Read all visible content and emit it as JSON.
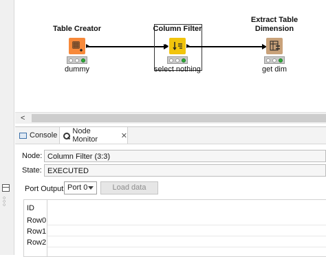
{
  "workflow": {
    "nodes": [
      {
        "title_lines": [
          "Table Creator"
        ],
        "label": "dummy",
        "icon": "table-creator-icon",
        "color": "#f7893a"
      },
      {
        "title_lines": [
          "Column Filter"
        ],
        "label": "select nothing",
        "icon": "column-filter-icon",
        "color": "#f2c40c"
      },
      {
        "title_lines": [
          "Extract Table",
          "Dimension"
        ],
        "label": "get dim",
        "icon": "extract-dimension-icon",
        "color": "#c9a27a"
      }
    ]
  },
  "panel": {
    "tabs": [
      {
        "label": "Console",
        "icon": "console-icon"
      },
      {
        "label": "Node Monitor",
        "icon": "node-monitor-icon"
      }
    ],
    "node_label": "Node:",
    "node_value": "Column Filter   (3:3)",
    "state_label": "State:",
    "state_value": "EXECUTED",
    "port_output_label": "Port Output",
    "port_select": "Port 0",
    "load_button": "Load data",
    "table": {
      "header": "ID",
      "rows": [
        "Row0",
        "Row1",
        "Row2"
      ]
    }
  },
  "colors": {
    "status_green": "#2fae3a",
    "table_creator": "#f7893a",
    "column_filter": "#f2c40c",
    "extract_dimension": "#c9a27a"
  }
}
